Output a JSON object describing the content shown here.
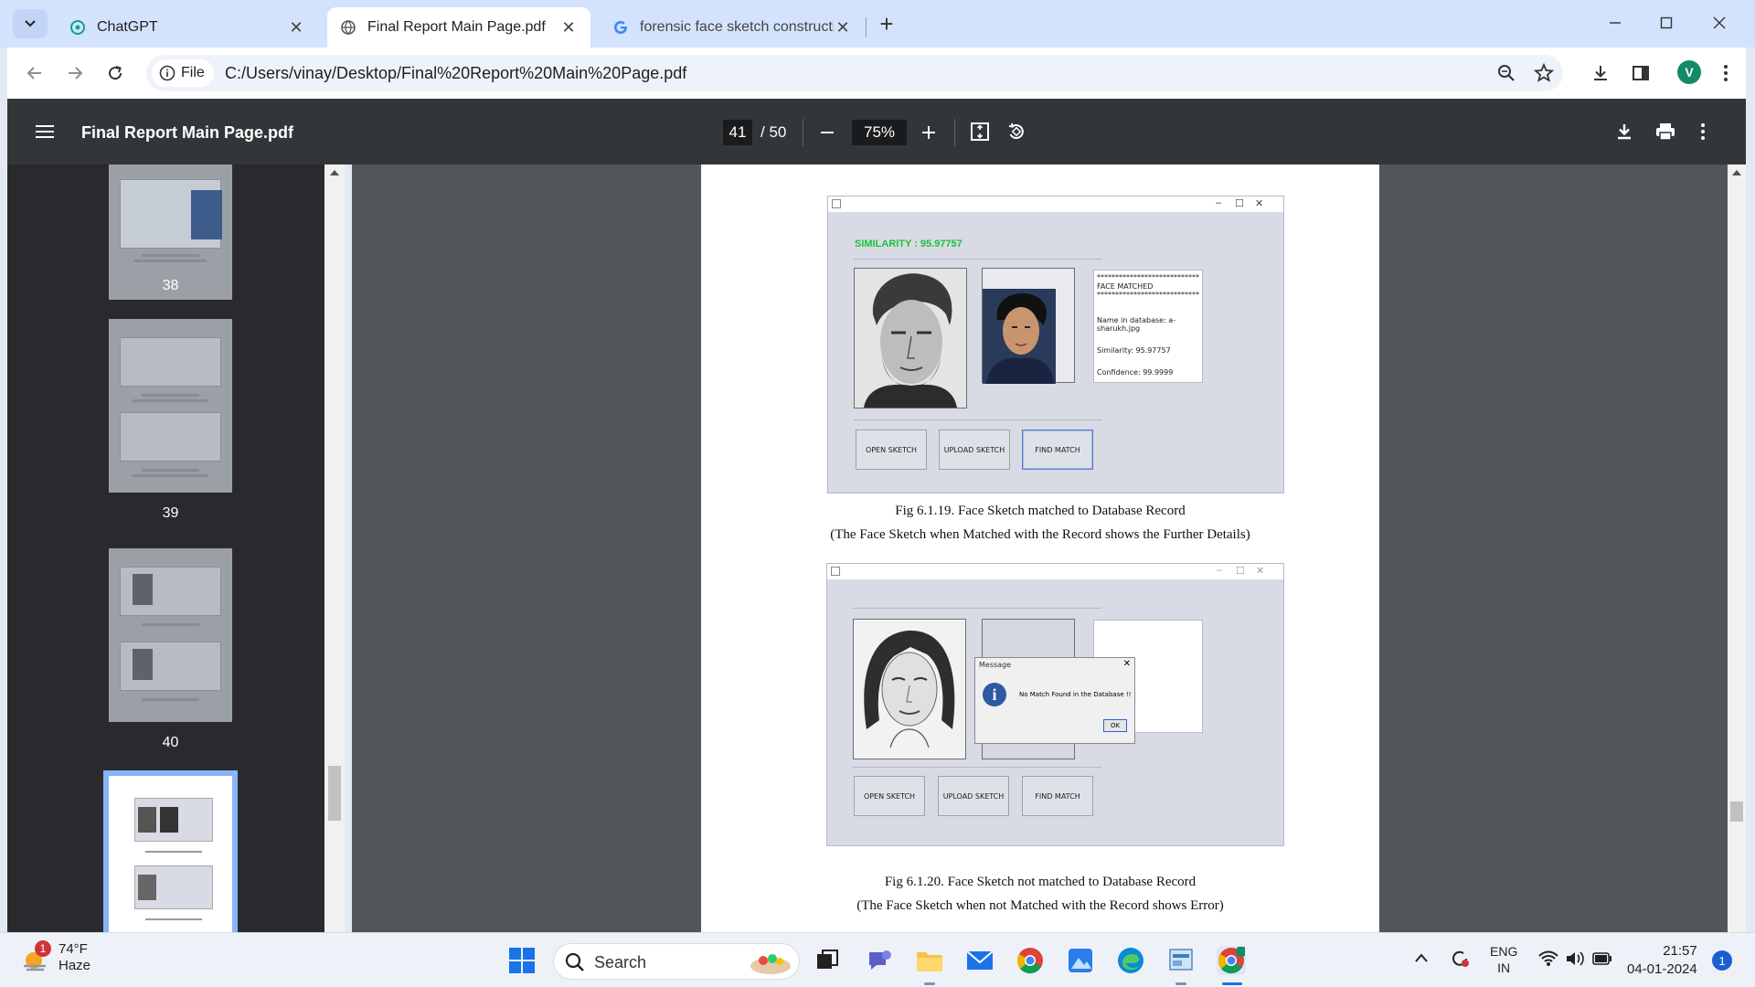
{
  "browser": {
    "tabs": [
      {
        "title": "ChatGPT"
      },
      {
        "title": "Final Report Main Page.pdf"
      },
      {
        "title": "forensic face sketch constructio"
      }
    ],
    "url_chip": "File",
    "url": "C:/Users/vinay/Desktop/Final%20Report%20Main%20Page.pdf",
    "profile_initial": "V"
  },
  "pdf": {
    "title": "Final Report Main Page.pdf",
    "current_page": "41",
    "total_pages": "/ 50",
    "zoom": "75%",
    "thumbnails": [
      {
        "page": "38"
      },
      {
        "page": "39"
      },
      {
        "page": "40"
      }
    ]
  },
  "figure1": {
    "similarity": "SIMILARITY : 95.97757",
    "info_lines": [
      "****************************************",
      "FACE MATCHED",
      "****************************************",
      "Name in database: a-sharukh.jpg",
      "Similarity: 95.97757",
      "Confidence: 99.9999"
    ],
    "buttons": [
      "OPEN SKETCH",
      "UPLOAD SKETCH",
      "FIND MATCH"
    ],
    "caption1": "Fig 6.1.19. Face Sketch matched to Database Record",
    "caption2": "(The Face Sketch when Matched with the Record shows the Further Details)"
  },
  "figure2": {
    "dialog_title": "Message",
    "dialog_message": "No Match Found in the Database !!",
    "dialog_ok": "OK",
    "buttons": [
      "OPEN SKETCH",
      "UPLOAD SKETCH",
      "FIND MATCH"
    ],
    "caption1": "Fig 6.1.20. Face Sketch not matched to Database Record",
    "caption2": "(The Face Sketch when not Matched with the Record shows Error)"
  },
  "taskbar": {
    "weather_badge": "1",
    "temperature": "74°F",
    "condition": "Haze",
    "search_label": "Search",
    "lang_top": "ENG",
    "lang_bottom": "IN",
    "time": "21:57",
    "date": "04-01-2024",
    "notification_count": "1"
  },
  "colors": {
    "tabstrip": "#d3e3fd",
    "pdf_toolbar": "#323639",
    "sidebar": "#2a2a2e",
    "doc_background": "#525659",
    "similarity_green": "#18c43a"
  }
}
